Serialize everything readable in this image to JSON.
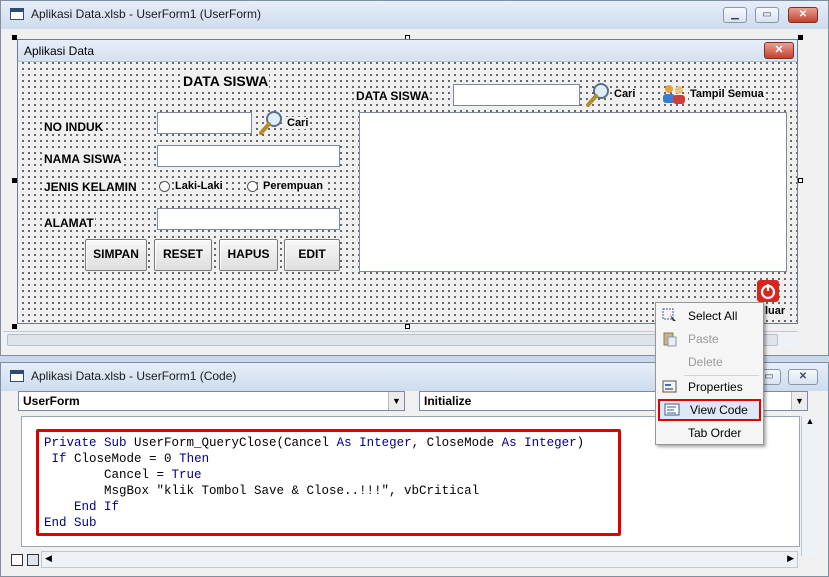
{
  "designer": {
    "title": "Aplikasi Data.xlsb - UserForm1 (UserForm)",
    "controls": {
      "minimize": "▁",
      "maximize": "▭",
      "close": "✕"
    }
  },
  "form": {
    "caption": "Aplikasi Data",
    "close": "✕",
    "heading": "DATA SISWA",
    "fields": {
      "no_induk": "NO INDUK",
      "nama_siswa": "NAMA SISWA",
      "jenis_kelamin": "JENIS KELAMIN",
      "alamat": "ALAMAT"
    },
    "gender_options": [
      "Laki-Laki",
      "Perempuan"
    ],
    "cari_label": "Cari",
    "buttons": {
      "simpan": "SIMPAN",
      "reset": "RESET",
      "hapus": "HAPUS",
      "edit": "EDIT"
    },
    "search_label": "DATA SISWA",
    "search_cari": "Cari",
    "tampil_semua": "Tampil Semua",
    "keluar": "luar"
  },
  "context_menu": {
    "items": [
      {
        "label": "Select All",
        "icon": "select-all-icon",
        "enabled": true
      },
      {
        "label": "Paste",
        "icon": "paste-icon",
        "enabled": false
      },
      {
        "label": "Delete",
        "icon": "",
        "enabled": false
      },
      {
        "label": "Properties",
        "icon": "properties-icon",
        "enabled": true
      },
      {
        "label": "View Code",
        "icon": "view-code-icon",
        "enabled": true,
        "highlighted": true
      },
      {
        "label": "Tab Order",
        "icon": "",
        "enabled": true
      }
    ]
  },
  "code_window": {
    "title": "Aplikasi Data.xlsb - UserForm1 (Code)",
    "object_select": "UserForm",
    "procedure_select": "Initialize",
    "code_lines": [
      "Private Sub UserForm_QueryClose(Cancel As Integer, CloseMode As Integer)",
      " If CloseMode = 0 Then",
      "        Cancel = True",
      "        MsgBox \"klik Tombol Save & Close..!!!\", vbCritical",
      "    End If",
      "End Sub"
    ]
  },
  "colors": {
    "highlight_box": "#e00000",
    "keyword": "#00008b"
  }
}
